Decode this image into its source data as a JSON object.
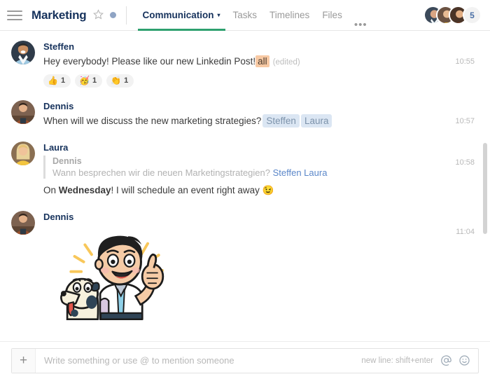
{
  "header": {
    "menu_icon": "hamburger-menu-icon",
    "title": "Marketing",
    "star_icon": "★",
    "tabs": [
      {
        "label": "Communication",
        "active": true,
        "caret": "▾"
      },
      {
        "label": "Tasks",
        "active": false
      },
      {
        "label": "Timelines",
        "active": false
      },
      {
        "label": "Files",
        "active": false
      }
    ],
    "more_tabs": "•••",
    "member_count": "5",
    "accent_color": "#2ea06f"
  },
  "messages": [
    {
      "author": "Steffen",
      "time": "10:55",
      "text_before": "Hey everybody! Please like our new Linkedin Post!",
      "mention_all": "all",
      "edited": "(edited)",
      "reactions": [
        {
          "emoji": "👍",
          "count": "1"
        },
        {
          "emoji": "🥳",
          "count": "1"
        },
        {
          "emoji": "👏",
          "count": "1"
        }
      ]
    },
    {
      "author": "Dennis",
      "time": "10:57",
      "text_before": "When will we discuss the new marketing strategies?",
      "mentions": [
        "Steffen",
        "Laura"
      ]
    },
    {
      "author": "Laura",
      "time": "10:58",
      "quote": {
        "author": "Dennis",
        "text": "Wann besprechen wir die neuen Marketingstrategien?",
        "mentions": "Steffen Laura"
      },
      "reply_prefix": "On ",
      "reply_bold": "Wednesday",
      "reply_suffix": "! I will schedule an event right away ",
      "reply_emoji": "😉"
    },
    {
      "author": "Dennis",
      "time": "11:04",
      "sticker": "thumbs-up-boy-with-dog-sticker"
    }
  ],
  "composer": {
    "add_label": "+",
    "placeholder": "Write something or use @ to mention someone",
    "hint": "new line: shift+enter",
    "mention_icon": "@",
    "emoji_icon": "emoji-smiley-icon"
  }
}
